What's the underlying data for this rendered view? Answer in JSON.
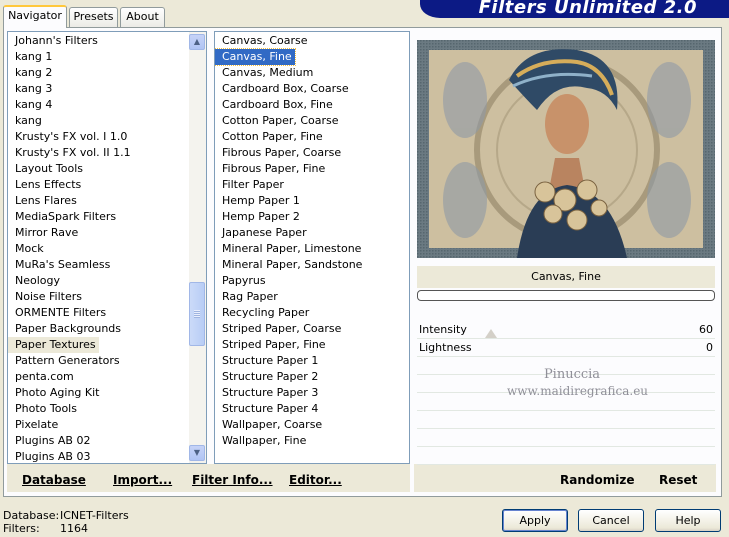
{
  "banner": {
    "title": "Filters Unlimited 2.0"
  },
  "tabs": [
    {
      "label": "Navigator"
    },
    {
      "label": "Presets"
    },
    {
      "label": "About"
    }
  ],
  "categories": {
    "items": [
      "Johann's Filters",
      "kang 1",
      "kang 2",
      "kang 3",
      "kang 4",
      "kang",
      "Krusty's FX vol. I 1.0",
      "Krusty's FX vol. II 1.1",
      "Layout Tools",
      "Lens Effects",
      "Lens Flares",
      "MediaSpark Filters",
      "Mirror Rave",
      "Mock",
      "MuRa's Seamless",
      "Neology",
      "Noise Filters",
      "ORMENTE Filters",
      "Paper Backgrounds",
      "Paper Textures",
      "Pattern Generators",
      "penta.com",
      "Photo Aging Kit",
      "Photo Tools",
      "Pixelate",
      "Plugins AB 02",
      "Plugins AB 03"
    ],
    "selected_index": 19
  },
  "filters": {
    "items": [
      "Canvas, Coarse",
      "Canvas, Fine",
      "Canvas, Medium",
      "Cardboard Box, Coarse",
      "Cardboard Box, Fine",
      "Cotton Paper, Coarse",
      "Cotton Paper, Fine",
      "Fibrous Paper, Coarse",
      "Fibrous Paper, Fine",
      "Filter Paper",
      "Hemp Paper 1",
      "Hemp Paper 2",
      "Japanese Paper",
      "Mineral Paper, Limestone",
      "Mineral Paper, Sandstone",
      "Papyrus",
      "Rag Paper",
      "Recycling Paper",
      "Striped Paper, Coarse",
      "Striped Paper, Fine",
      "Structure Paper 1",
      "Structure Paper 2",
      "Structure Paper 3",
      "Structure Paper 4",
      "Wallpaper, Coarse",
      "Wallpaper, Fine"
    ],
    "selected_index": 1
  },
  "links": {
    "database": "Database",
    "import": "Import...",
    "filter_info": "Filter Info...",
    "editor": "Editor...",
    "randomize": "Randomize",
    "reset": "Reset"
  },
  "effect": {
    "name": "Canvas, Fine"
  },
  "params": [
    {
      "label": "Intensity",
      "value": "60"
    },
    {
      "label": "Lightness",
      "value": "0"
    }
  ],
  "watermark": {
    "line1": "Pinuccia",
    "line2": "www.maidiregrafica.eu"
  },
  "status": {
    "database_label": "Database:",
    "database_value": "ICNET-Filters",
    "filters_label": "Filters:",
    "filters_value": "1164"
  },
  "buttons": {
    "apply": "Apply",
    "cancel": "Cancel",
    "help": "Help"
  },
  "colors": {
    "banner": "#0c1a85",
    "selection": "#316ac5",
    "accent_tab": "#ffc83c"
  }
}
